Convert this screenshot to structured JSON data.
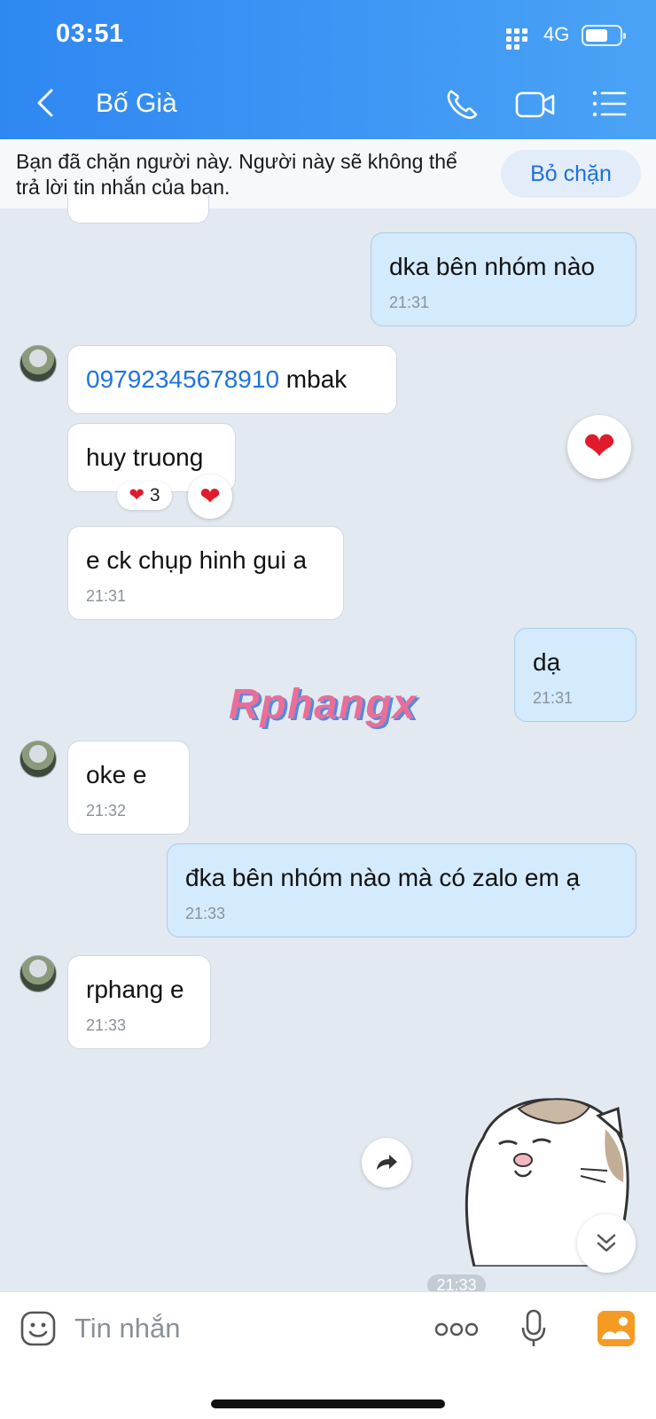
{
  "status": {
    "time": "03:51",
    "network": "4G"
  },
  "header": {
    "title": "Bố Già"
  },
  "block_notice": {
    "text": "Bạn đã chặn người này. Người này sẽ không thể trả lời tin nhắn của bạn.",
    "unblock_label": "Bỏ chặn"
  },
  "messages": [
    {
      "dir": "out",
      "text": "dka bên nhóm nào",
      "time": "21:31"
    },
    {
      "dir": "in",
      "phone": "09792345678910",
      "text": " mbak"
    },
    {
      "dir": "in",
      "text": "huy truong",
      "reaction": "3"
    },
    {
      "dir": "in",
      "text": "e ck chụp hinh gui a",
      "time": "21:31"
    },
    {
      "dir": "out",
      "text": "dạ",
      "time": "21:31"
    },
    {
      "dir": "in",
      "text": "oke e",
      "time": "21:32"
    },
    {
      "dir": "out",
      "text": "đka bên nhóm nào mà có zalo em ạ",
      "time": "21:33"
    },
    {
      "dir": "in",
      "text": "rphang e",
      "time": "21:33"
    }
  ],
  "sticker_time": "21:33",
  "watermark": "Rphangx",
  "input": {
    "placeholder": "Tin nhắn"
  },
  "icons": [
    "back-icon",
    "phone-icon",
    "video-icon",
    "menu-icon",
    "heart-icon",
    "share-icon",
    "chevron-down-icon",
    "emoji-icon",
    "more-icon",
    "mic-icon",
    "image-icon"
  ]
}
